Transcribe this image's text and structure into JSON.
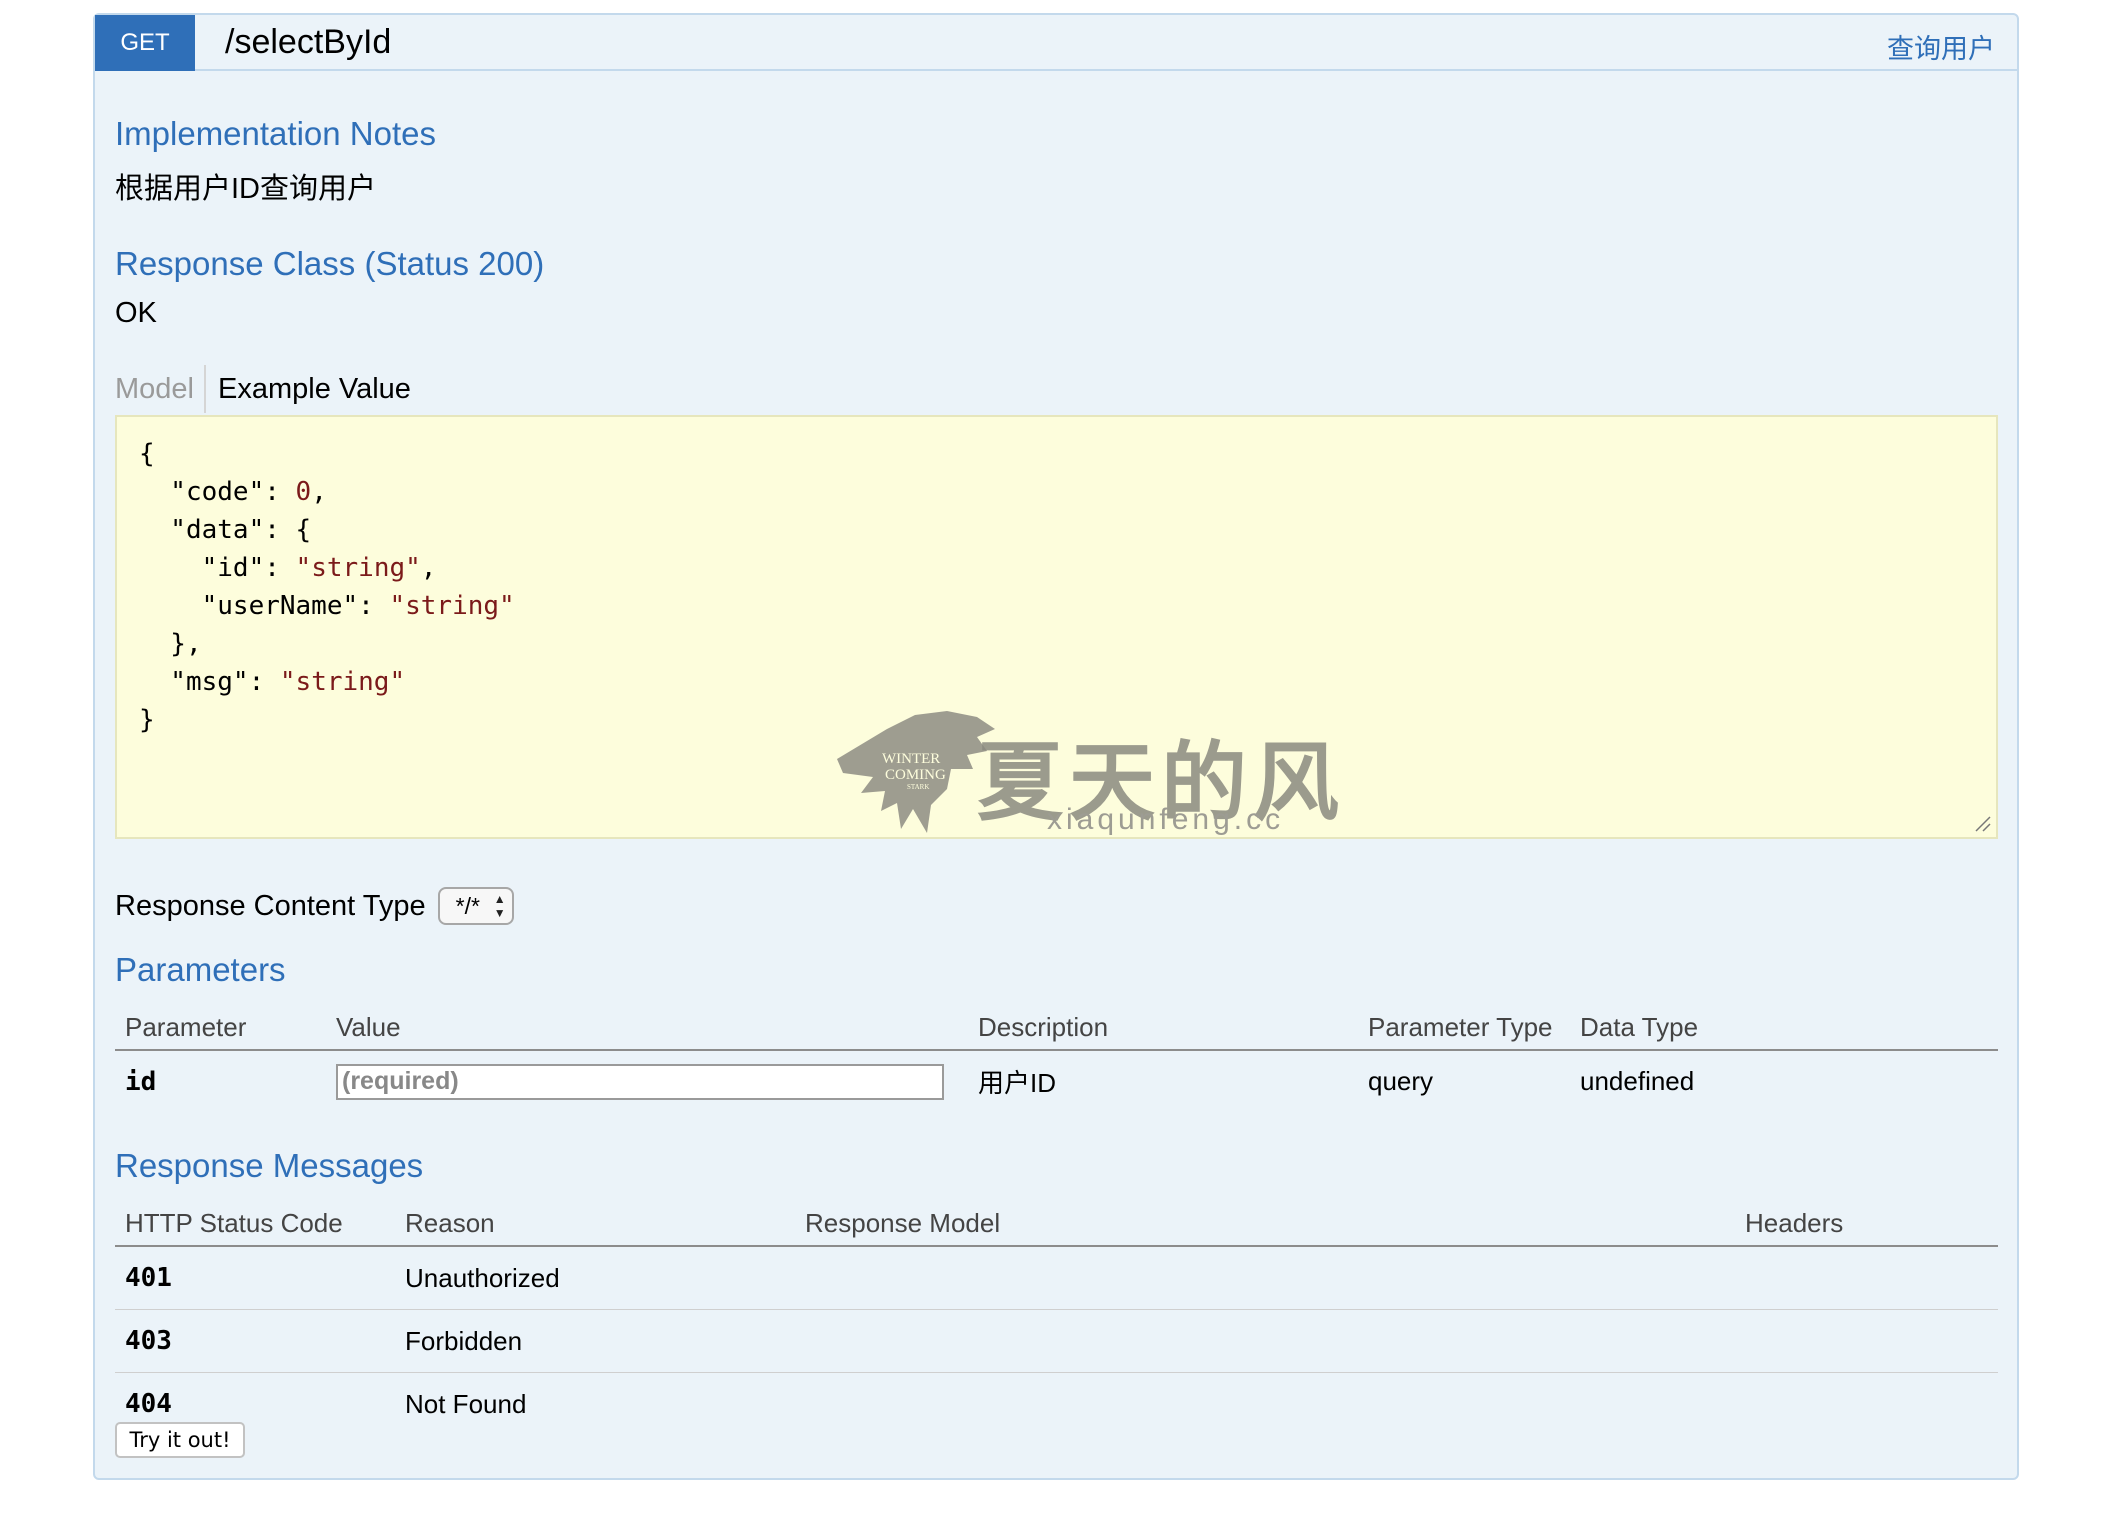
{
  "operation": {
    "method": "GET",
    "path": "/selectById",
    "summary": "查询用户"
  },
  "implementation_notes": {
    "title": "Implementation Notes",
    "text": "根据用户ID查询用户"
  },
  "response_class": {
    "title": "Response Class (Status 200)",
    "status_text": "OK",
    "tabs": {
      "model": "Model",
      "example": "Example Value"
    },
    "example_json": {
      "open": "{",
      "code_key": "  \"code\": ",
      "code_value": "0",
      "comma": ",",
      "data_key": "  \"data\": {",
      "id_key": "    \"id\": ",
      "id_value": "\"string\"",
      "username_key": "    \"userName\": ",
      "username_value": "\"string\"",
      "data_close": "  },",
      "msg_key": "  \"msg\": ",
      "msg_value": "\"string\"",
      "close": "}"
    }
  },
  "watermark": {
    "emblem_text_1": "WINTER",
    "emblem_text_2": "COMING",
    "emblem_text_3": "STARK",
    "title": "夏天的风",
    "subtitle": "xiaqunfeng.cc"
  },
  "response_content_type": {
    "label": "Response Content Type",
    "selected": "*/*"
  },
  "parameters": {
    "title": "Parameters",
    "headers": [
      "Parameter",
      "Value",
      "Description",
      "Parameter Type",
      "Data Type"
    ],
    "rows": [
      {
        "name": "id",
        "placeholder": "(required)",
        "description": "用户ID",
        "param_type": "query",
        "data_type": "undefined"
      }
    ]
  },
  "response_messages": {
    "title": "Response Messages",
    "headers": [
      "HTTP Status Code",
      "Reason",
      "Response Model",
      "Headers"
    ],
    "rows": [
      {
        "code": "401",
        "reason": "Unauthorized"
      },
      {
        "code": "403",
        "reason": "Forbidden"
      },
      {
        "code": "404",
        "reason": "Not Found"
      }
    ]
  },
  "try_button": "Try it out!",
  "colors": {
    "accent": "#2f6fb8",
    "panel_bg": "#ebf3f9",
    "panel_border": "#c3d9ec",
    "example_bg": "#fdfddc",
    "json_value": "#7b1a1a"
  }
}
